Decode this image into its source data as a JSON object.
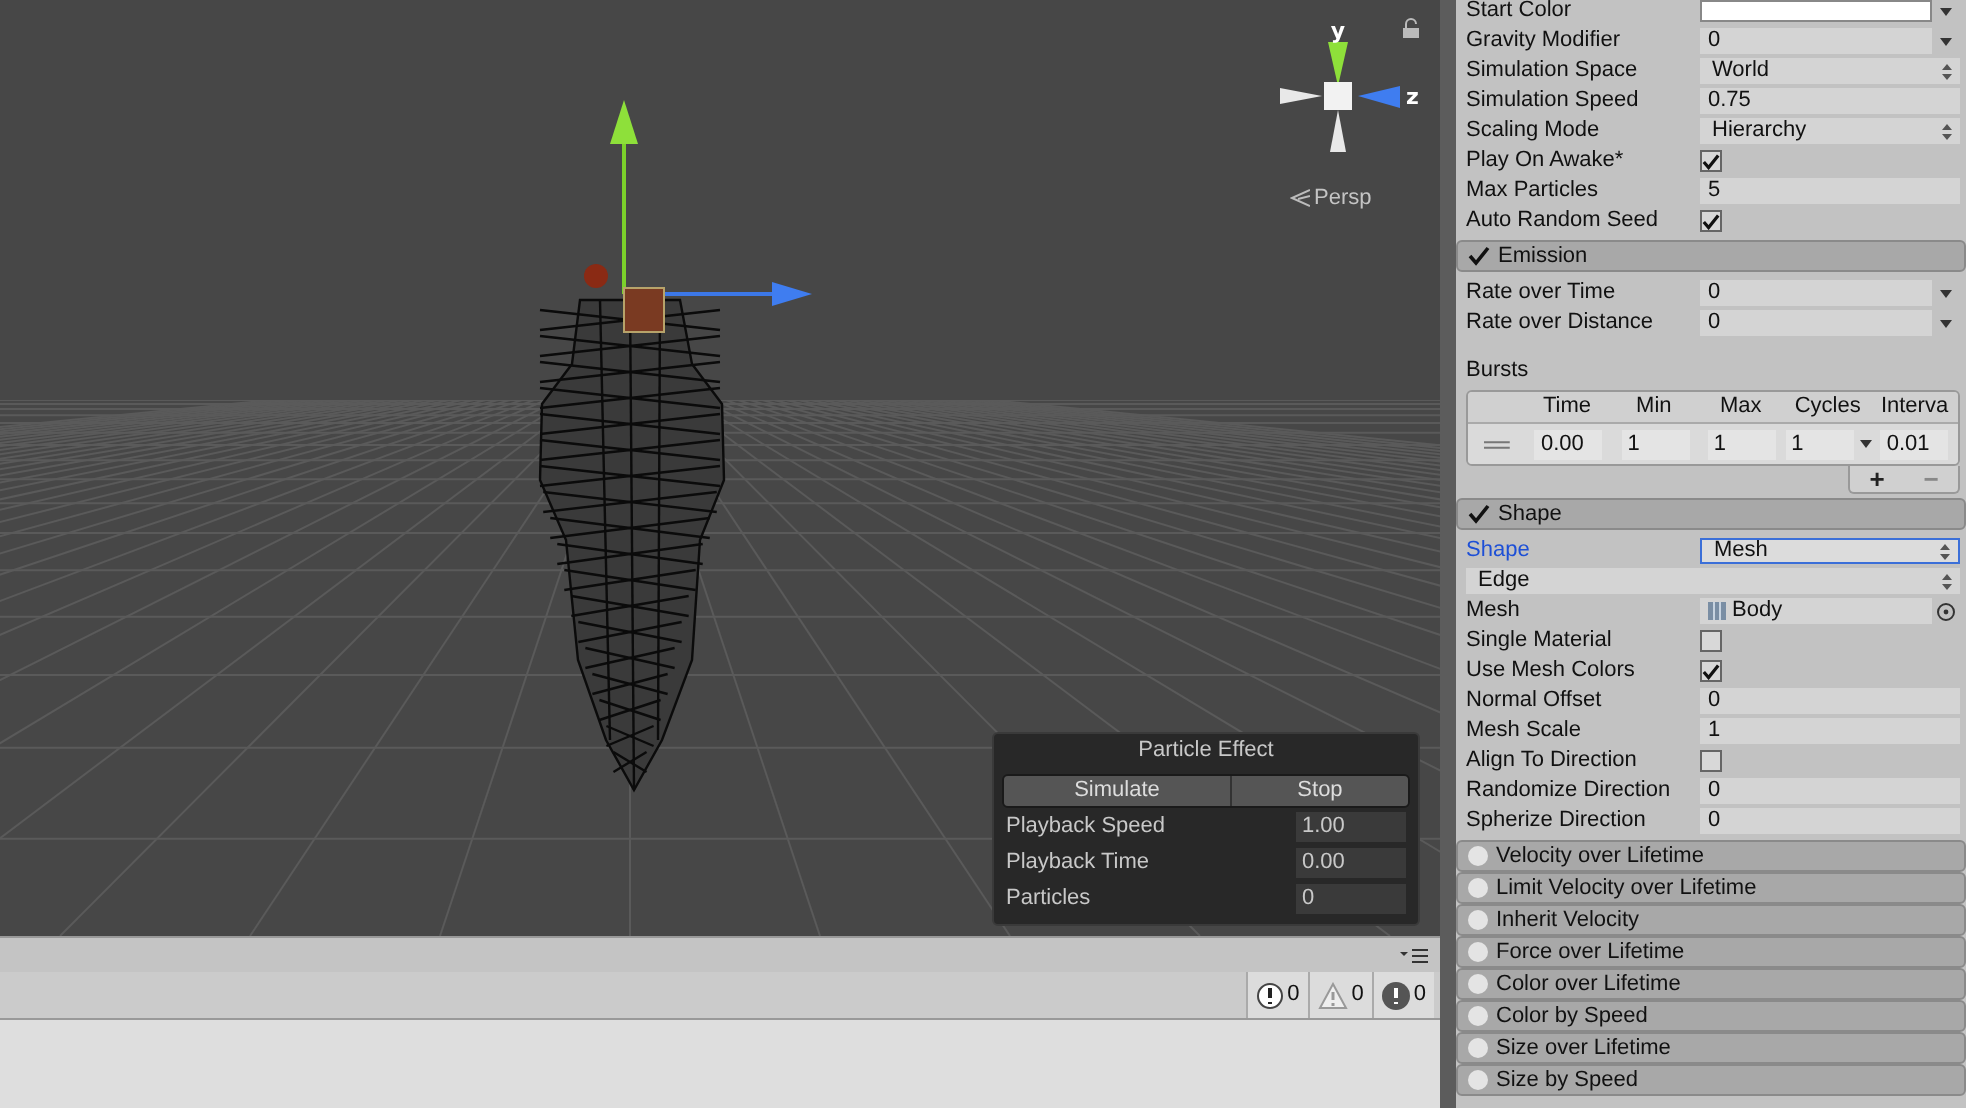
{
  "scene": {
    "axis_labels": [
      "y",
      "z"
    ],
    "projection": "Persp"
  },
  "particle_effect": {
    "title": "Particle Effect",
    "buttons": [
      "Simulate",
      "Stop"
    ],
    "fields": [
      {
        "label": "Playback Speed",
        "value": "1.00"
      },
      {
        "label": "Playback Time",
        "value": "0.00"
      },
      {
        "label": "Particles",
        "value": "0"
      }
    ]
  },
  "console": {
    "counts": [
      {
        "kind": "info",
        "count": "0"
      },
      {
        "kind": "warning",
        "count": "0"
      },
      {
        "kind": "error",
        "count": "0"
      }
    ]
  },
  "inspector": {
    "main_rows": [
      {
        "kind": "color",
        "label": "Start Color",
        "color": "#ffffff"
      },
      {
        "kind": "curve",
        "label": "Gravity Modifier",
        "value": "0"
      },
      {
        "kind": "enum",
        "label": "Simulation Space",
        "value": "World"
      },
      {
        "kind": "number",
        "label": "Simulation Speed",
        "value": "0.75"
      },
      {
        "kind": "enum",
        "label": "Scaling Mode",
        "value": "Hierarchy"
      },
      {
        "kind": "checkbox",
        "label": "Play On Awake*",
        "checked": true
      },
      {
        "kind": "number",
        "label": "Max Particles",
        "value": "5"
      },
      {
        "kind": "checkbox",
        "label": "Auto Random Seed",
        "checked": true
      }
    ],
    "modules": [
      {
        "title": "Emission",
        "enabled": true,
        "rows": [
          {
            "kind": "curve",
            "label": "Rate over Time",
            "value": "0"
          },
          {
            "kind": "curve",
            "label": "Rate over Distance",
            "value": "0"
          }
        ],
        "bursts": {
          "label": "Bursts",
          "columns": [
            "Time",
            "Min",
            "Max",
            "Cycles",
            "Interva"
          ],
          "rows": [
            [
              "0.00",
              "1",
              "1",
              "1",
              "0.01"
            ]
          ],
          "buttons": [
            "+",
            "−"
          ]
        }
      },
      {
        "title": "Shape",
        "enabled": true,
        "rows": [
          {
            "kind": "enum",
            "label": "Shape",
            "value": "Mesh",
            "focused": true
          },
          {
            "kind": "enum_wide",
            "value": "Edge"
          },
          {
            "kind": "object",
            "label": "Mesh",
            "value": "Body"
          },
          {
            "kind": "checkbox",
            "label": "Single Material",
            "checked": false
          },
          {
            "kind": "checkbox",
            "label": "Use Mesh Colors",
            "checked": true
          },
          {
            "kind": "number",
            "label": "Normal Offset",
            "value": "0"
          },
          {
            "kind": "number",
            "label": "Mesh Scale",
            "value": "1"
          },
          {
            "kind": "checkbox",
            "label": "Align To Direction",
            "checked": false
          },
          {
            "kind": "number",
            "label": "Randomize Direction",
            "value": "0"
          },
          {
            "kind": "number",
            "label": "Spherize Direction",
            "value": "0"
          }
        ]
      },
      {
        "title": "Velocity over Lifetime",
        "enabled": false
      },
      {
        "title": "Limit Velocity over Lifetime",
        "enabled": false
      },
      {
        "title": "Inherit Velocity",
        "enabled": false
      },
      {
        "title": "Force over Lifetime",
        "enabled": false
      },
      {
        "title": "Color over Lifetime",
        "enabled": false
      },
      {
        "title": "Color by Speed",
        "enabled": false
      },
      {
        "title": "Size over Lifetime",
        "enabled": false
      },
      {
        "title": "Size by Speed",
        "enabled": false
      }
    ]
  }
}
